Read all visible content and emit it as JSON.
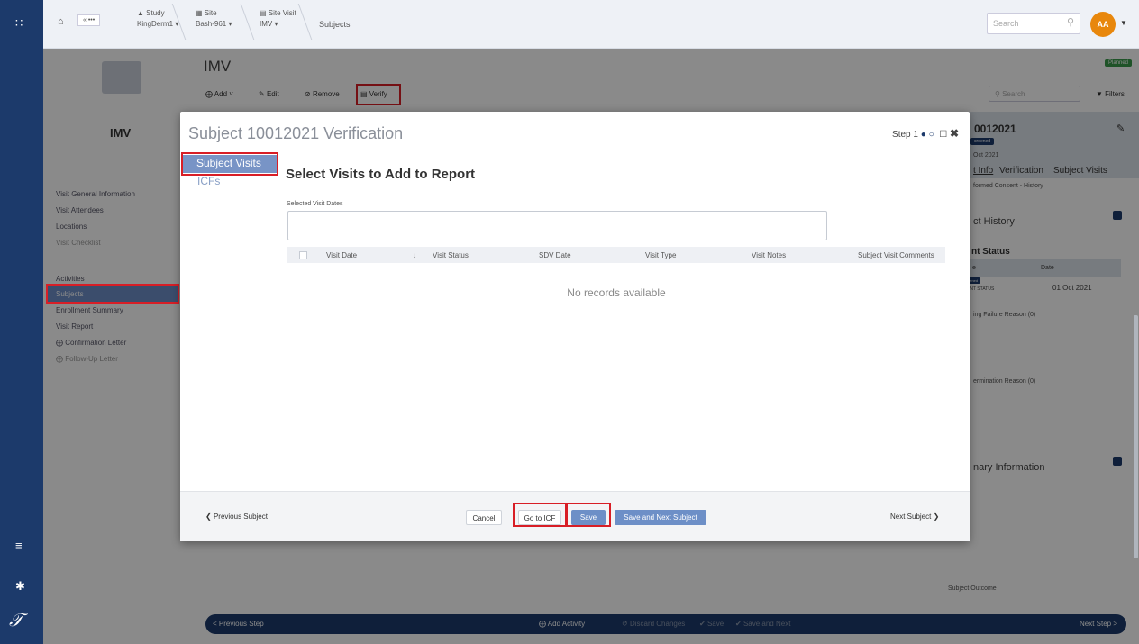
{
  "topbar": {
    "home_label": "« •••",
    "study_label": "Study",
    "study_value": "KingDerm1 ▾",
    "site_label": "Site",
    "site_value": "Bash-961 ▾",
    "site_visit_label": "Site Visit",
    "site_visit_value": "IMV ▾",
    "current": "Subjects",
    "search_placeholder": "Search",
    "avatar": "AA"
  },
  "left_nav": {
    "title": "IMV",
    "items": [
      "Visit General Information",
      "Visit Attendees",
      "Locations",
      "Visit Checklist",
      "Activities",
      "Subjects",
      "Enrollment Summary",
      "Visit Report",
      "Confirmation Letter",
      "Follow-Up Letter"
    ]
  },
  "content": {
    "title": "IMV",
    "toolbar": {
      "add": "Add ˅",
      "edit": "Edit",
      "remove": "Remove",
      "verify": "Verify"
    }
  },
  "right_panel": {
    "status": "Planned",
    "search_placeholder": "Search",
    "filters": "Filters",
    "subject_id": "0012021",
    "badge": "creened",
    "date": "Oct 2021",
    "tabs": [
      "t Info",
      "Verification",
      "Subject Visits"
    ],
    "history_link": "formed Consent - History",
    "history_heading": "ct History",
    "status_heading": "nt Status",
    "col_e": "e",
    "col_date": "Date",
    "row_badge": "eened",
    "row_status": "ENT STATUS",
    "row_date": "01 Oct 2021",
    "screening_failure": "ing Failure Reason (0)",
    "termination": "ermination Reason (0)",
    "summary": "nary Information",
    "subject_outcome": "Subject Outcome"
  },
  "bottom_bar": {
    "prev": "< Previous Step",
    "add_activity": "Add Activity",
    "discard": "Discard Changes",
    "save": "Save",
    "save_next": "Save and Next",
    "next": "Next Step >"
  },
  "modal": {
    "title": "Subject 10012021 Verification",
    "step": "Step 1",
    "side_tabs": [
      "Subject Visits",
      "ICFs"
    ],
    "heading": "Select Visits to Add to Report",
    "selected_label": "Selected Visit Dates",
    "columns": [
      "Visit Date",
      "Visit Status",
      "SDV Date",
      "Visit Type",
      "Visit Notes",
      "Subject Visit Comments"
    ],
    "sort_indicator": "↓",
    "empty": "No records available",
    "footer": {
      "prev": "Previous Subject",
      "cancel": "Cancel",
      "go_icf": "Go to ICF",
      "save": "Save",
      "save_next": "Save and Next Subject",
      "next": "Next Subject"
    }
  },
  "colors": {
    "rail": "#1c3a6b",
    "accent": "#6d8fc7",
    "highlight": "#d81e26",
    "avatar": "#e8870c"
  }
}
